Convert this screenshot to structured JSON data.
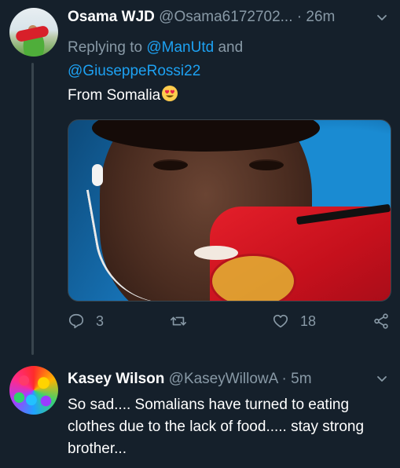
{
  "tweets": [
    {
      "display_name": "Osama WJD",
      "handle": "@Osama6172702...",
      "separator": "·",
      "time": "26m",
      "replying_prefix": "Replying to",
      "mention_1": "@ManUtd",
      "and": "and",
      "mention_2": "@GiuseppeRossi22",
      "text": "From Somalia",
      "emoji": "heart-eyes-emoji",
      "reply_count": "3",
      "retweet_count": "",
      "like_count": "18"
    },
    {
      "display_name": "Kasey Wilson",
      "handle": "@KaseyWillowA",
      "separator": "·",
      "time": "5m",
      "text": "So sad.... Somalians have turned to eating clothes due to the lack of food..... stay strong brother..."
    }
  ],
  "colors": {
    "background": "#15202b",
    "secondary_text": "#8899a6",
    "link": "#1da1f2",
    "thread_line": "#38444d"
  }
}
